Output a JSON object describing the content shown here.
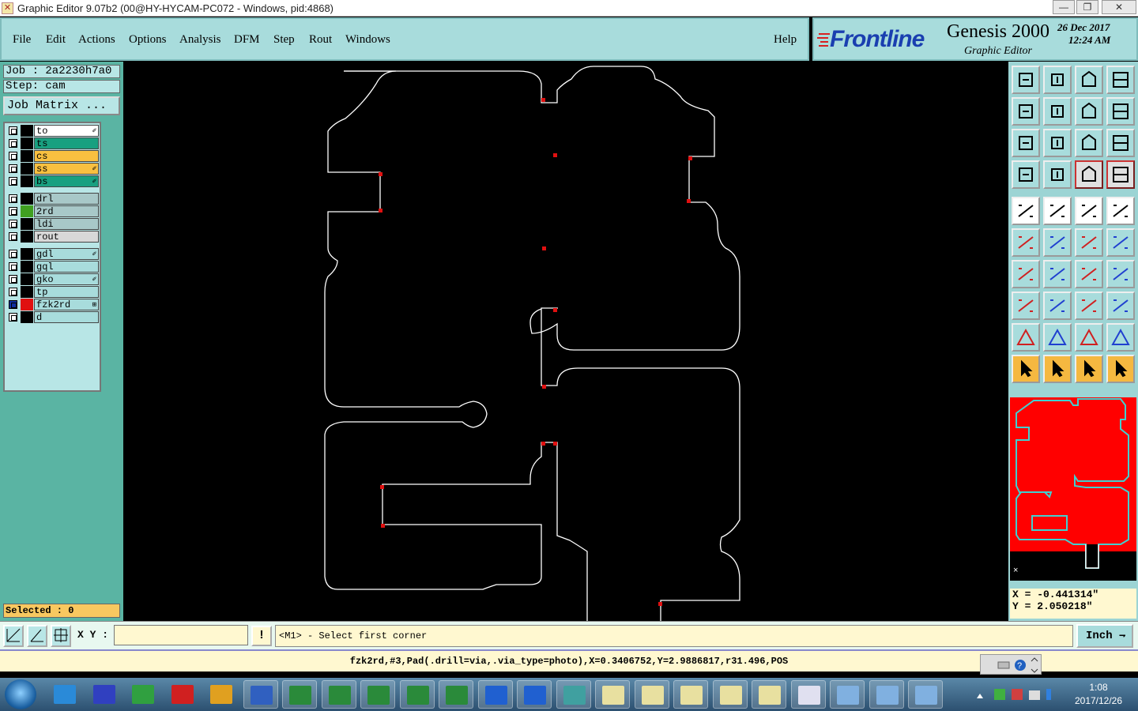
{
  "window": {
    "title": "Graphic Editor 9.07b2 (00@HY-HYCAM-PC072 - Windows, pid:4868)"
  },
  "menu": {
    "file": "File",
    "edit": "Edit",
    "actions": "Actions",
    "options": "Options",
    "analysis": "Analysis",
    "dfm": "DFM",
    "step": "Step",
    "rout": "Rout",
    "windows": "Windows",
    "help": "Help"
  },
  "brand": {
    "logo": "Frontline",
    "product": "Genesis 2000",
    "subtitle": "Graphic Editor",
    "date": "26 Dec 2017",
    "time": "12:24 AM"
  },
  "job": {
    "job_label": "Job : 2a2230h7a0",
    "step_label": "Step: cam",
    "matrix_button": "Job Matrix ..."
  },
  "layers": [
    {
      "name": "to",
      "color": "#ffffff",
      "swatch": "#000000",
      "mark": "✐"
    },
    {
      "name": "ts",
      "color": "#18a080",
      "swatch": "#000000",
      "mark": ""
    },
    {
      "name": "cs",
      "color": "#f8c040",
      "swatch": "#000000",
      "mark": ""
    },
    {
      "name": "ss",
      "color": "#f8c040",
      "swatch": "#000000",
      "mark": "✐"
    },
    {
      "name": "bs",
      "color": "#18a080",
      "swatch": "#000000",
      "mark": "✐"
    },
    {
      "name": "drl",
      "color": "#a8c8c8",
      "swatch": "#000000",
      "mark": ""
    },
    {
      "name": "2rd",
      "color": "#a8c8c8",
      "swatch": "#40a020",
      "mark": ""
    },
    {
      "name": "ldi",
      "color": "#a8c8c8",
      "swatch": "#000000",
      "mark": ""
    },
    {
      "name": "rout",
      "color": "#d8d8d8",
      "swatch": "#000000",
      "mark": ""
    },
    {
      "name": "gdl",
      "color": "#a8dcdc",
      "swatch": "#000000",
      "mark": "✐"
    },
    {
      "name": "gql",
      "color": "#a8dcdc",
      "swatch": "#000000",
      "mark": ""
    },
    {
      "name": "gko",
      "color": "#a8dcdc",
      "swatch": "#000000",
      "mark": "✐"
    },
    {
      "name": "tp",
      "color": "#a8dcdc",
      "swatch": "#000000",
      "mark": ""
    },
    {
      "name": "fzk2rd",
      "color": "#a8dcdc",
      "swatch": "#e01010",
      "mark": "⊞"
    },
    {
      "name": "d",
      "color": "#a8dcdc",
      "swatch": "#000000",
      "mark": ""
    }
  ],
  "selected": "Selected : 0",
  "coords": {
    "x": "X = -0.441314\"",
    "y": "Y = 2.050218\""
  },
  "command": {
    "xy_label": "X Y :",
    "xy_value": "",
    "prompt": "<M1> - Select first corner",
    "unit": "Inch"
  },
  "status": "fzk2rd,#3,Pad(.drill=via,.via_type=photo),X=0.3406752,Y=2.9886817,r31.496,POS",
  "taskbar": {
    "time": "1:08",
    "date": "2017/12/26"
  },
  "colors": {
    "panel": "#a8dcdc",
    "accent": "#e01010",
    "outline": "#ffffff",
    "minimap_fill": "#ff0000",
    "minimap_stroke": "#40d0d0"
  }
}
